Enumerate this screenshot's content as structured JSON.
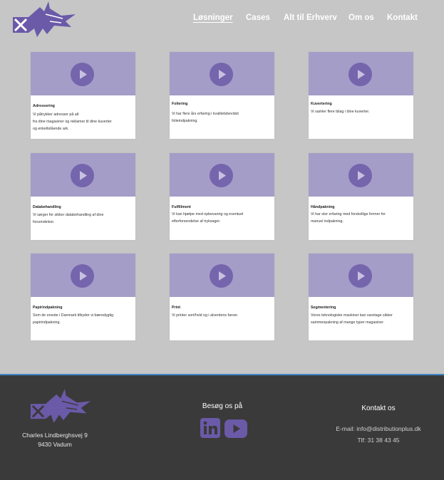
{
  "nav": {
    "items": [
      "Løsninger",
      "Cases",
      "Alt til Erhverv",
      "Om os",
      "Kontakt"
    ]
  },
  "cards": [
    {
      "title": "Adressering",
      "desc_lines": [
        "Vi påtrykker adresser på alt",
        "fra dine magasiner og reklamer til dine kuverter",
        "og enkeltstående ark."
      ]
    },
    {
      "title": "Foliering",
      "desc_lines": [
        "Vi har flere års erfaring i kvalitetsbevidst",
        "folieindpakning."
      ]
    },
    {
      "title": "Kuvertering",
      "desc_lines": [
        "Vi samler flere bilag i dine kuverter."
      ]
    },
    {
      "title": "Databehandling",
      "desc_lines": [
        "Vi sørger for sikker databehandling af dine",
        "forsendelser."
      ]
    },
    {
      "title": "Fulfillment",
      "desc_lines": [
        "Vi kan hjælpe med opbevaring og eventuel",
        "efterforsendelse af tryksager."
      ]
    },
    {
      "title": "Håndpakning",
      "desc_lines": [
        "Vi har stor erfaring med forskellige former for",
        "manuel indpakning."
      ]
    },
    {
      "title": "Papirindpakning",
      "desc_lines": [
        "Som de eneste i Danmark tilbyder vi bæredygtig",
        "papirindpakning."
      ]
    },
    {
      "title": "Print",
      "desc_lines": [
        "Vi printer sort/hvid og i alverdens farver."
      ]
    },
    {
      "title": "Segmentering",
      "desc_lines": [
        "Vores teknologiske maskiner kan varetage sikker",
        "sammenpakning af mange typer magasiner."
      ]
    }
  ],
  "footer": {
    "address_line1": "Charles Lindberghsvej 9",
    "address_line2": "9430 Vadum",
    "visit_heading": "Besøg os på",
    "contact_heading": "Kontakt os",
    "email_label": "E-mail: ",
    "email": "info@distributionplus.dk",
    "phone": "Tlf: 31 38 43 45"
  },
  "icons": {
    "logo": "x-logo-icon",
    "play": "play-icon",
    "linkedin": "linkedin-icon",
    "youtube": "youtube-icon"
  },
  "colors": {
    "background": "#c6c6c6",
    "accent_purple": "#7565ad",
    "thumb_purple": "#a49dc8",
    "footer_bg": "#3a3a3a",
    "footer_border": "#3d84c6"
  }
}
